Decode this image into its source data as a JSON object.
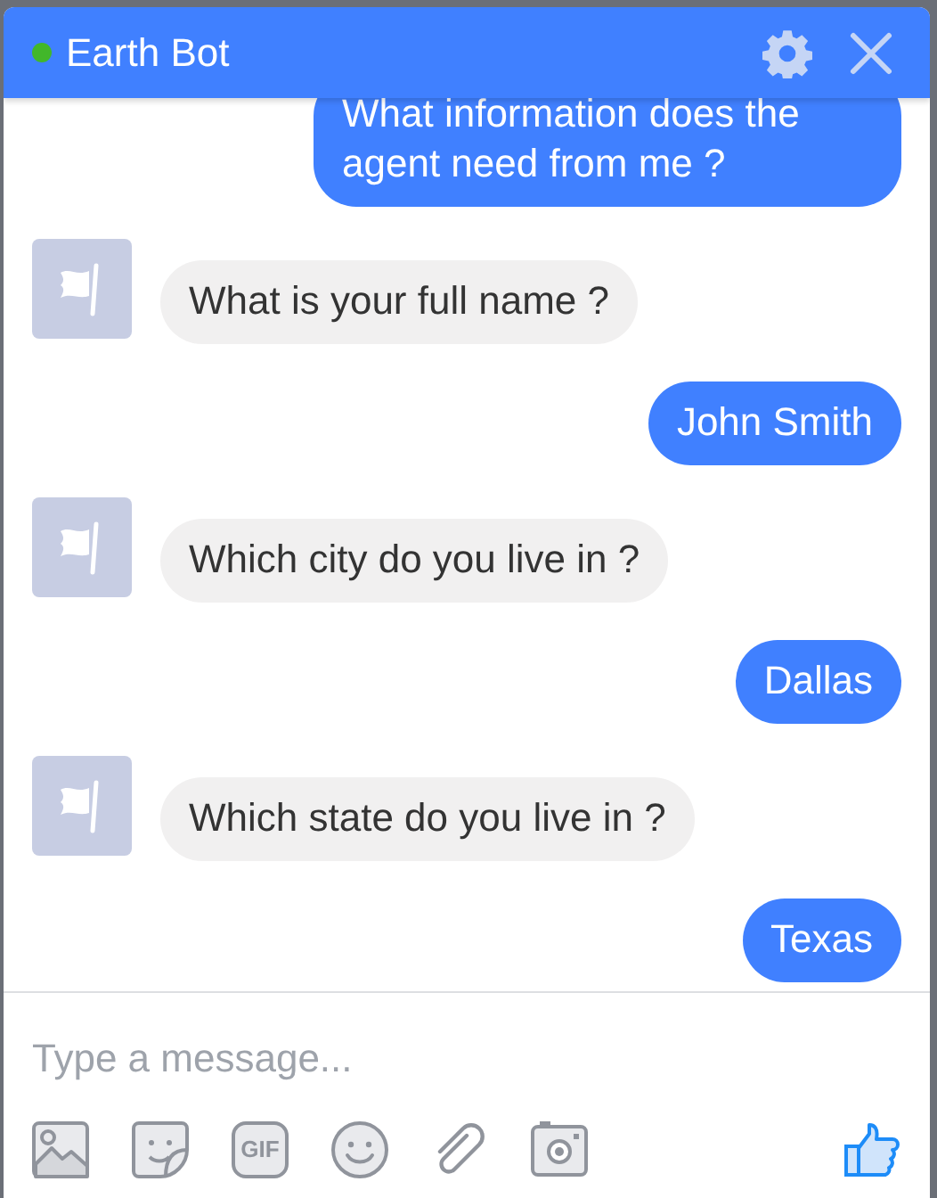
{
  "header": {
    "title": "Earth Bot",
    "online": true
  },
  "messages": [
    {
      "kind": "sent",
      "text": "What information does the agent need from me ?"
    },
    {
      "kind": "received",
      "text": "What is your full name ?"
    },
    {
      "kind": "sent",
      "text": "John Smith"
    },
    {
      "kind": "received",
      "text": "Which city do you live in ?"
    },
    {
      "kind": "sent",
      "text": "Dallas"
    },
    {
      "kind": "received",
      "text": "Which state do you live in ?"
    },
    {
      "kind": "sent",
      "text": "Texas"
    }
  ],
  "composer": {
    "placeholder": "Type a message..."
  },
  "toolbar": [
    {
      "kind": "image"
    },
    {
      "kind": "sticker"
    },
    {
      "kind": "gif",
      "label": "GIF"
    },
    {
      "kind": "emoji"
    },
    {
      "kind": "attach"
    },
    {
      "kind": "camera"
    }
  ]
}
